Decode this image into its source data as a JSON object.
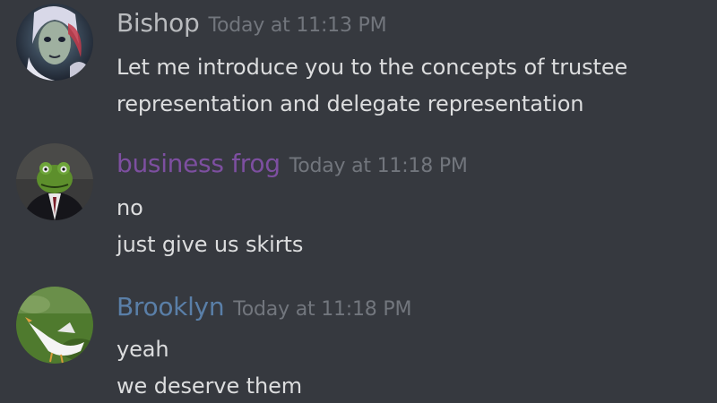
{
  "messages": [
    {
      "username": "Bishop",
      "username_color": "#b9bbbe",
      "timestamp": "Today at 11:13 PM",
      "lines": [
        "Let me introduce you to the concepts of trustee",
        "representation and delegate representation"
      ]
    },
    {
      "username": "business frog",
      "username_color": "#7d4fa0",
      "timestamp": "Today at 11:18 PM",
      "lines": [
        "no",
        "just give us skirts"
      ]
    },
    {
      "username": "Brooklyn",
      "username_color": "#5a7fa8",
      "timestamp": "Today at 11:18 PM",
      "lines": [
        "yeah",
        "we deserve them"
      ]
    }
  ],
  "avatars": {
    "bishop": "portrait-avatar-icon",
    "frog": "frog-in-suit-avatar-icon",
    "brooklyn": "white-goose-avatar-icon"
  }
}
